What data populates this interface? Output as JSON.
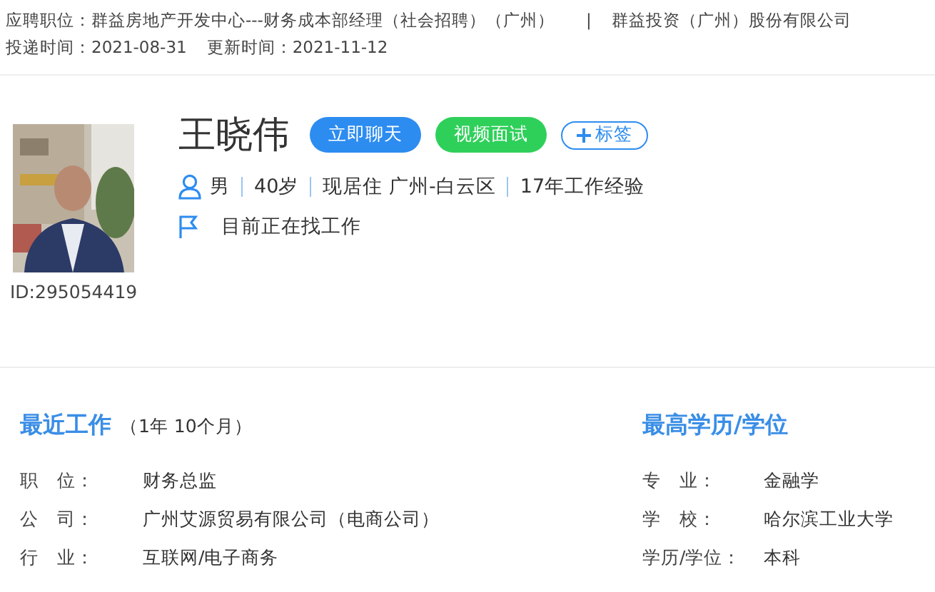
{
  "application": {
    "position_label": "应聘职位：",
    "position": "群益房地产开发中心---财务成本部经理（社会招聘）（广州）",
    "separator": "|",
    "company": "群益投资（广州）股份有限公司",
    "delivered_label": "投递时间：",
    "delivered": "2021-08-31",
    "updated_label": "更新时间：",
    "updated": "2021-11-12"
  },
  "candidate": {
    "id": "ID:295054419",
    "name": "王晓伟",
    "actions": [
      {
        "label": "立即聊天",
        "kind": "primary"
      },
      {
        "label": "视频面试",
        "kind": "video"
      },
      {
        "label": "标签",
        "kind": "tag"
      }
    ],
    "facts": [
      "男",
      "40岁",
      "现居住 广州-白云区",
      "17年工作经验"
    ],
    "status": "目前正在找工作"
  },
  "recent_work": {
    "title": "最近工作",
    "duration": "（1年 10个月）",
    "fields": [
      {
        "label": "职　位：",
        "value": "财务总监"
      },
      {
        "label": "公　司：",
        "value": "广州艾源贸易有限公司（电商公司）"
      },
      {
        "label": "行　业：",
        "value": "互联网/电子商务"
      }
    ]
  },
  "education": {
    "title": "最高学历/学位",
    "fields": [
      {
        "label": "专　业：",
        "value": "金融学"
      },
      {
        "label": "学　校：",
        "value": "哈尔滨工业大学"
      },
      {
        "label": "学历/学位：",
        "value": "本科"
      }
    ]
  }
}
